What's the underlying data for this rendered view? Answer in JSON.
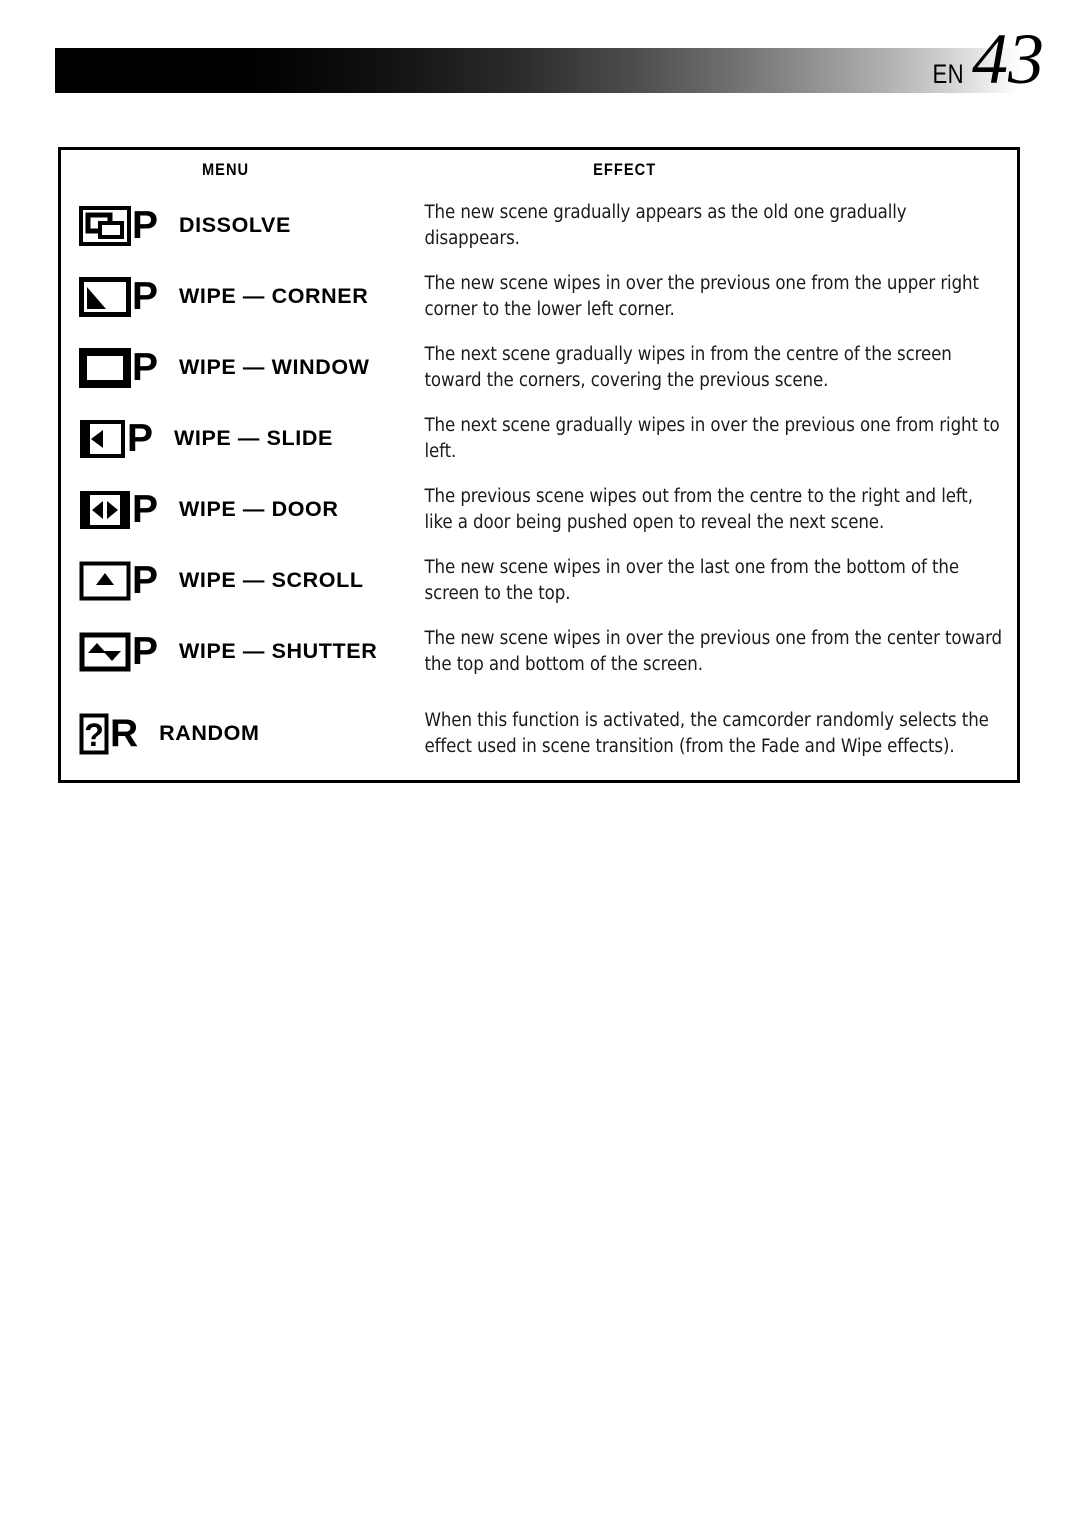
{
  "header": {
    "language_code": "EN",
    "page_number": "43"
  },
  "table": {
    "columns": [
      {
        "key": "menu",
        "label": "MENU"
      },
      {
        "key": "effect",
        "label": "EFFECT"
      }
    ],
    "rows": [
      {
        "icon_name": "dissolve-icon",
        "icon_letter": "P",
        "menu": "DISSOLVE",
        "effect": "The new scene gradually appears as the old one gradually disappears."
      },
      {
        "icon_name": "wipe-corner-icon",
        "icon_letter": "P",
        "menu": "WIPE — CORNER",
        "effect": "The new scene wipes in over the previous one from the upper right corner to the lower left corner."
      },
      {
        "icon_name": "wipe-window-icon",
        "icon_letter": "P",
        "menu": "WIPE — WINDOW",
        "effect": "The next scene gradually wipes in from the centre of the screen toward the corners, covering the previous scene."
      },
      {
        "icon_name": "wipe-slide-icon",
        "icon_letter": "P",
        "menu": "WIPE — SLIDE",
        "effect": "The next scene gradually wipes in over the previous one from right to left."
      },
      {
        "icon_name": "wipe-door-icon",
        "icon_letter": "P",
        "menu": "WIPE — DOOR",
        "effect": "The previous scene wipes out from the centre to the right and left, like a door being pushed open to reveal the next scene."
      },
      {
        "icon_name": "wipe-scroll-icon",
        "icon_letter": "P",
        "menu": "WIPE — SCROLL",
        "effect": "The new scene wipes in over the last one from the bottom of the screen to the top."
      },
      {
        "icon_name": "wipe-shutter-icon",
        "icon_letter": "P",
        "menu": "WIPE — SHUTTER",
        "effect": "The new scene wipes in over the previous one from the center toward the top and bottom of the screen."
      },
      {
        "icon_name": "random-icon",
        "icon_letter": "R",
        "menu": "RANDOM",
        "effect": "When this function is activated, the camcorder randomly selects the effect used in scene transition (from the Fade and Wipe effects)."
      }
    ]
  },
  "colors": {
    "ink": "#000000",
    "paper": "#ffffff",
    "gradient_from": "#000000",
    "gradient_to": "#ffffff"
  }
}
